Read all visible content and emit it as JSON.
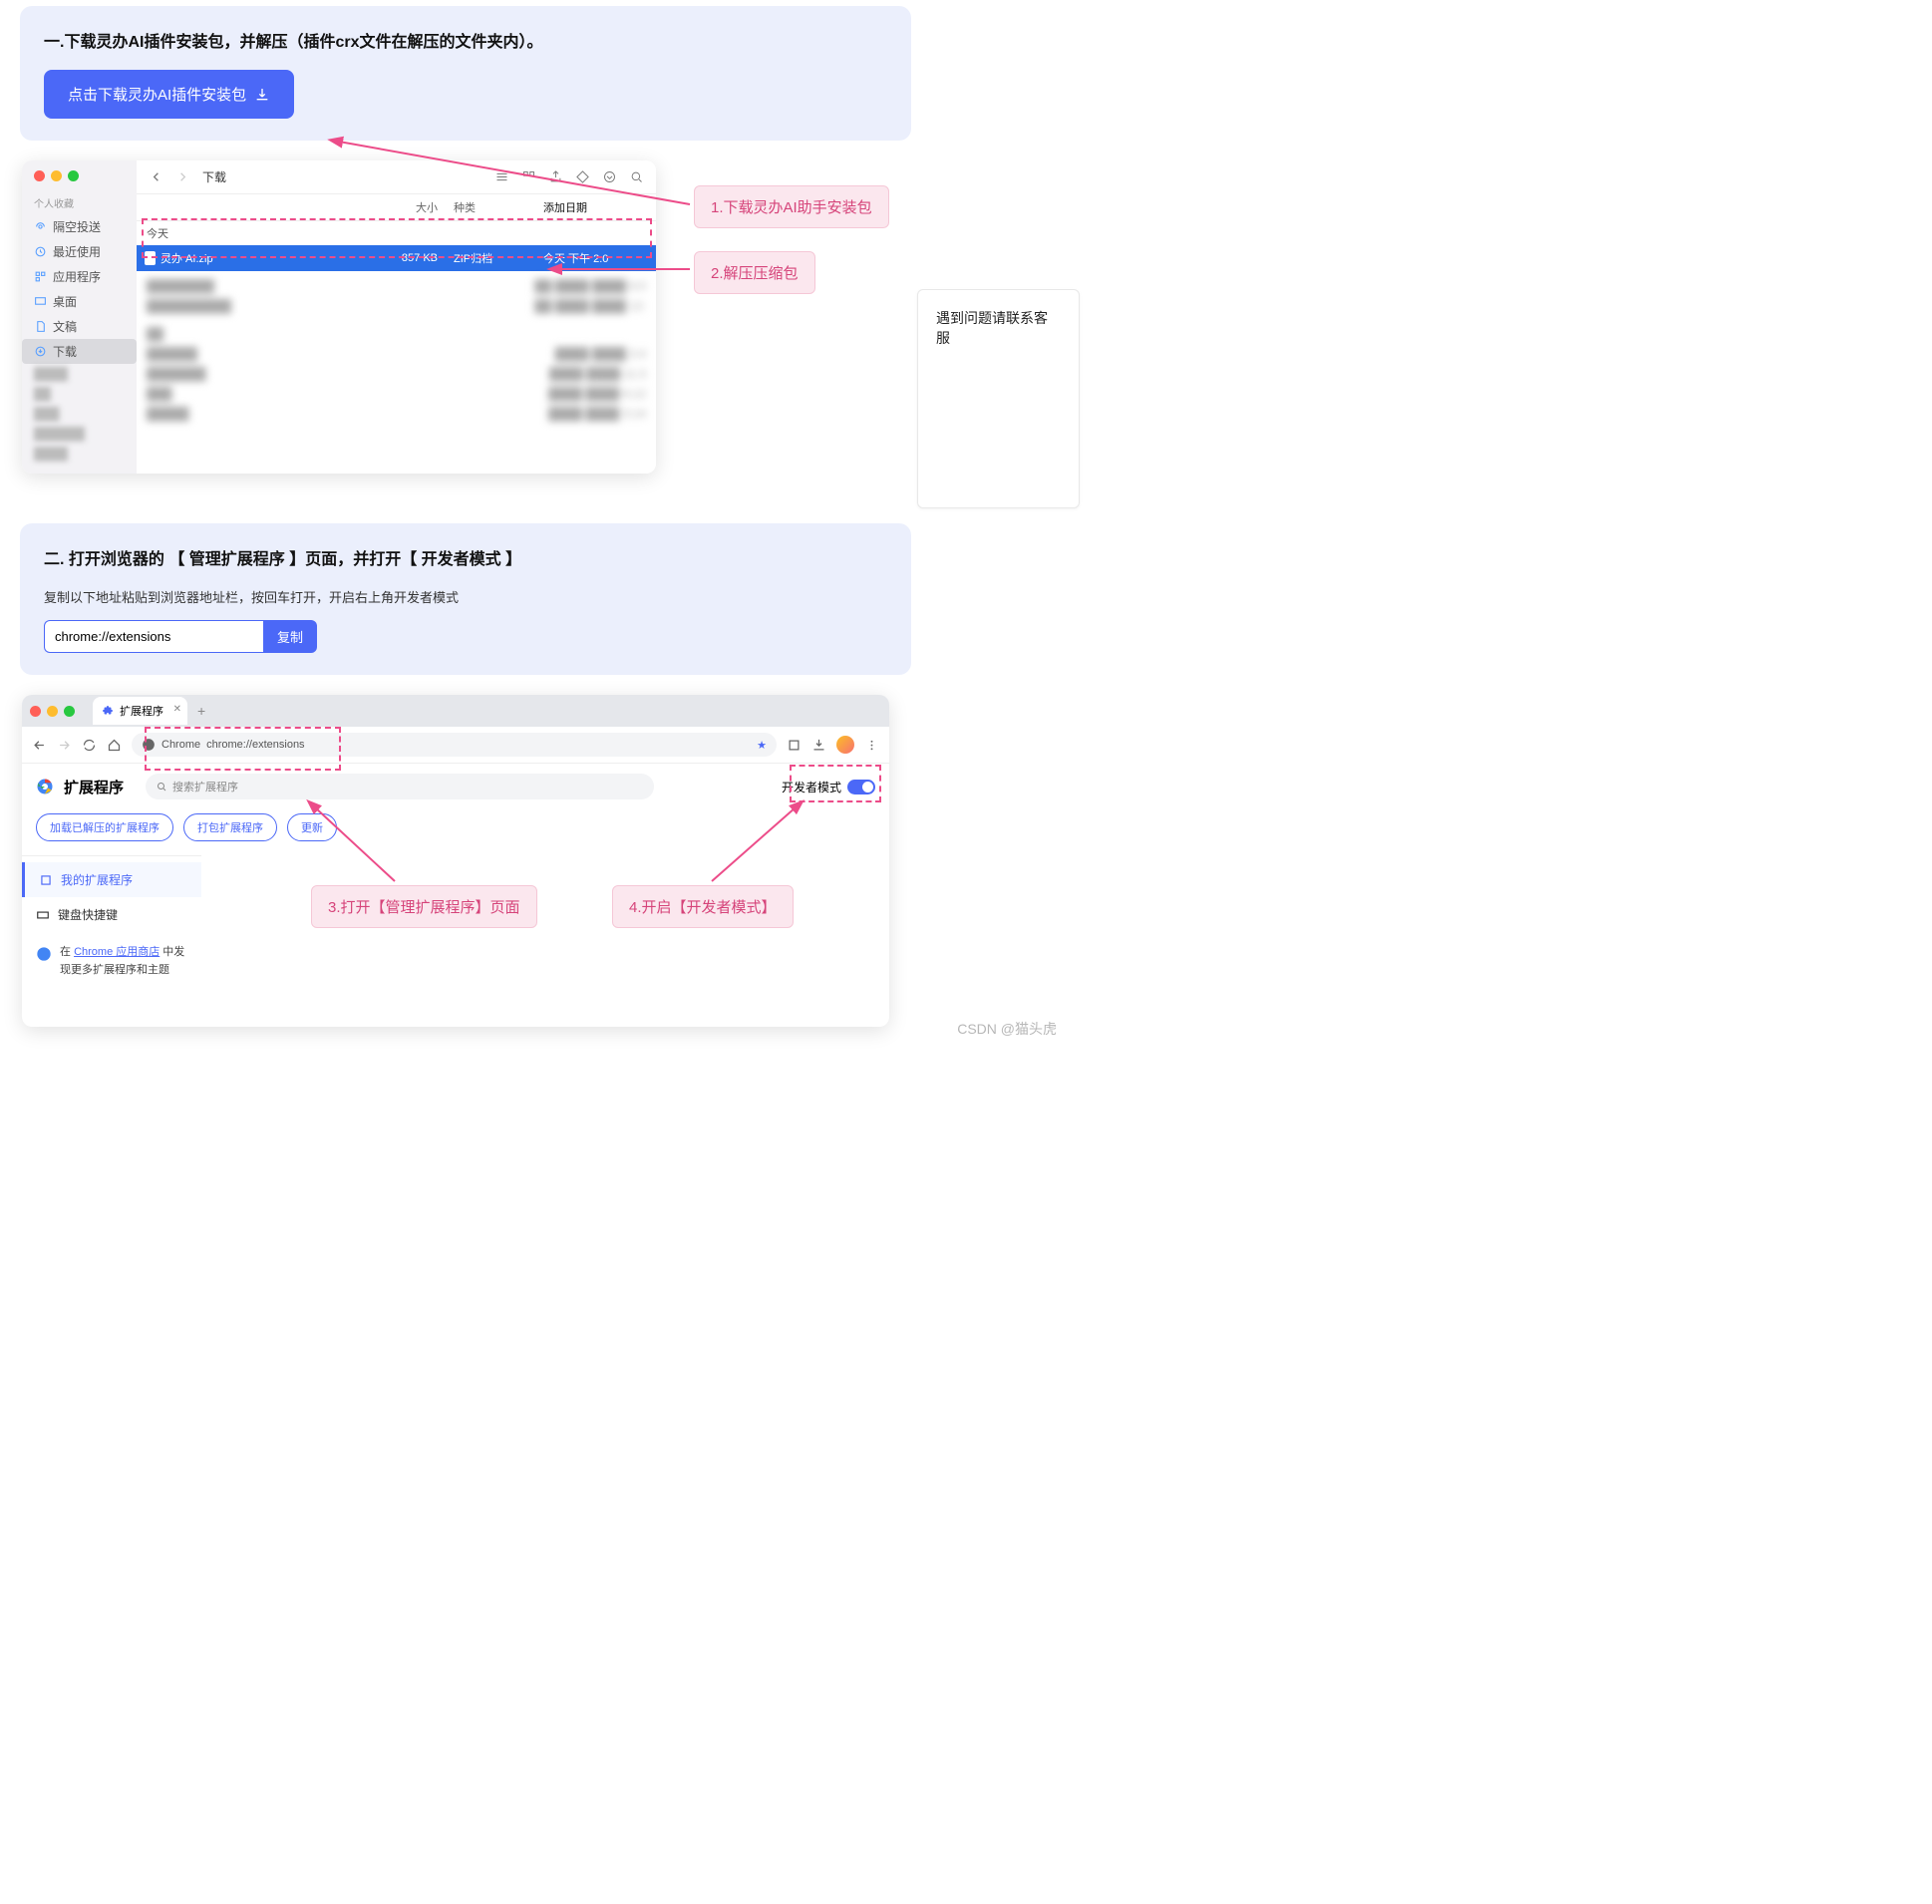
{
  "step1": {
    "title": "一.下载灵办AI插件安装包，并解压（插件crx文件在解压的文件夹内）。",
    "download_btn": "点击下载灵办AI插件安装包"
  },
  "step2": {
    "title": "二. 打开浏览器的 【 管理扩展程序 】页面，并打开【 开发者模式 】",
    "subtitle": "复制以下地址粘贴到浏览器地址栏，按回车打开，开启右上角开发者模式",
    "url": "chrome://extensions",
    "copy_btn": "复制"
  },
  "callouts": {
    "c1": "1.下载灵办AI助手安装包",
    "c2": "2.解压压缩包",
    "c3": "3.打开【管理扩展程序】页面",
    "c4": "4.开启【开发者模式】"
  },
  "side_note": "遇到问题请联系客服",
  "finder": {
    "title": "下载",
    "side_header": "个人收藏",
    "sidebar": [
      "隔空投送",
      "最近使用",
      "应用程序",
      "桌面",
      "文稿",
      "下载"
    ],
    "cols": {
      "name": "",
      "size": "大小",
      "kind": "种类",
      "date": "添加日期"
    },
    "group": "今天",
    "file": {
      "name": "灵办 AI.zip",
      "size": "857 KB",
      "kind": "ZIP归档",
      "date": "今天 下午 2:0"
    }
  },
  "chrome": {
    "tab": "扩展程序",
    "chrome_label": "Chrome",
    "url": "chrome://extensions",
    "page_title": "扩展程序",
    "search_ph": "搜索扩展程序",
    "dev_mode": "开发者模式",
    "btns": [
      "加载已解压的扩展程序",
      "打包扩展程序",
      "更新"
    ],
    "nav": {
      "my": "我的扩展程序",
      "kb": "键盘快捷键"
    },
    "store_pre": "在 ",
    "store_link": "Chrome 应用商店",
    "store_post": " 中发现更多扩展程序和主题"
  },
  "watermark": "CSDN @猫头虎"
}
